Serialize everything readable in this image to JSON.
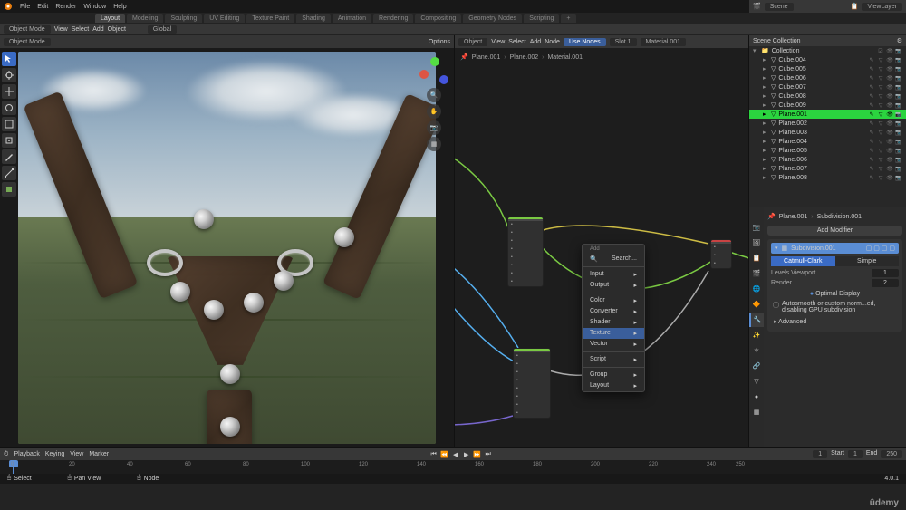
{
  "menus": [
    "File",
    "Edit",
    "Render",
    "Window",
    "Help"
  ],
  "workspaces": [
    "Layout",
    "Modeling",
    "Sculpting",
    "UV Editing",
    "Texture Paint",
    "Shading",
    "Animation",
    "Rendering",
    "Compositing",
    "Geometry Nodes",
    "Scripting"
  ],
  "active_workspace": "Layout",
  "scene_header": {
    "scene": "Scene",
    "viewlayer": "ViewLayer"
  },
  "viewport_header": {
    "mode": "Object Mode",
    "menus": [
      "View",
      "Select",
      "Add",
      "Object"
    ],
    "orient": "Global",
    "options": "Options"
  },
  "node_header": {
    "editor": "Object",
    "menus": [
      "View",
      "Select",
      "Add",
      "Node"
    ],
    "use_nodes": "Use Nodes",
    "slot": "Slot 1",
    "material": "Material.001"
  },
  "breadcrumbs": [
    "Plane.001",
    "Plane.002",
    "Material.001"
  ],
  "context_menu": {
    "title": "Add",
    "search": "Search...",
    "items": [
      "Input",
      "Output",
      "Color",
      "Converter",
      "Shader",
      "Texture",
      "Vector",
      "Script",
      "Group",
      "Layout"
    ],
    "highlighted": "Texture"
  },
  "outliner_header": "Scene Collection",
  "collection": "Collection",
  "outliner": [
    {
      "name": "Cube.004",
      "sel": false
    },
    {
      "name": "Cube.005",
      "sel": false
    },
    {
      "name": "Cube.006",
      "sel": false
    },
    {
      "name": "Cube.007",
      "sel": false
    },
    {
      "name": "Cube.008",
      "sel": false
    },
    {
      "name": "Cube.009",
      "sel": false
    },
    {
      "name": "Plane.001",
      "sel": true
    },
    {
      "name": "Plane.002",
      "sel": false
    },
    {
      "name": "Plane.003",
      "sel": false
    },
    {
      "name": "Plane.004",
      "sel": false
    },
    {
      "name": "Plane.005",
      "sel": false
    },
    {
      "name": "Plane.006",
      "sel": false
    },
    {
      "name": "Plane.007",
      "sel": false
    },
    {
      "name": "Plane.008",
      "sel": false
    }
  ],
  "props_bc": [
    "Plane.001",
    "Subdivision.001"
  ],
  "modifier": {
    "add": "Add Modifier",
    "name": "Subdivision.001",
    "tab_a": "Catmull-Clark",
    "tab_b": "Simple",
    "viewport_label": "Levels Viewport",
    "viewport_val": "1",
    "render_label": "Render",
    "render_val": "2",
    "optimal": "Optimal Display",
    "autosmooth": "Autosmooth or custom norm...ed, disabling GPU subdivision",
    "advanced": "Advanced"
  },
  "timeline": {
    "menus": [
      "Playback",
      "Keying",
      "View",
      "Marker"
    ],
    "start_label": "Start",
    "start": "1",
    "end_label": "End",
    "end": "250",
    "frame": "1",
    "ticks": [
      0,
      20,
      40,
      60,
      80,
      100,
      120,
      140,
      160,
      180,
      200,
      220,
      240,
      250
    ]
  },
  "statusbar": {
    "select": "Select",
    "pan": "Pan View",
    "node": "Node",
    "version": "4.0.1"
  },
  "udemy": "ûdemy"
}
